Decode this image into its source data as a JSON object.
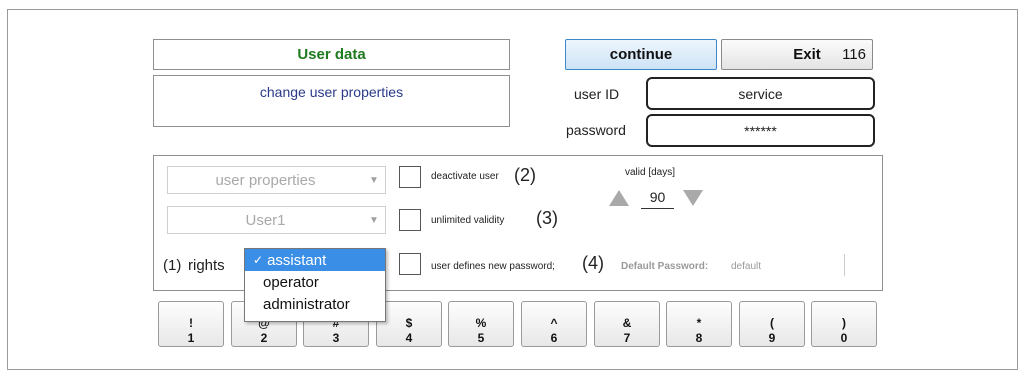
{
  "header": {
    "title": "User data",
    "subtitle": "change user properties",
    "continue_label": "continue",
    "exit_label": "Exit",
    "exit_number": "116"
  },
  "login": {
    "userid_label": "user ID",
    "userid_value": "service",
    "password_label": "password",
    "password_value": "******"
  },
  "settings": {
    "property_select": "user properties",
    "user_select": "User1",
    "rights_callout": "(1)",
    "rights_label": "rights",
    "rights_options": [
      "assistant",
      "operator",
      "administrator"
    ],
    "rights_selected_mark": "✓",
    "deactivate_label": "deactivate user",
    "deactivate_callout": "(2)",
    "unlimited_label": "unlimited validity",
    "unlimited_callout": "(3)",
    "newpw_label": "user defines new password;",
    "newpw_callout": "(4)",
    "default_pw_label": "Default Password:",
    "default_pw_value": "default",
    "valid_label": "valid [days]",
    "valid_value": "90"
  },
  "keypad": [
    {
      "top": "!",
      "bottom": "1"
    },
    {
      "top": "@",
      "bottom": "2"
    },
    {
      "top": "#",
      "bottom": "3"
    },
    {
      "top": "$",
      "bottom": "4"
    },
    {
      "top": "%",
      "bottom": "5"
    },
    {
      "top": "^",
      "bottom": "6"
    },
    {
      "top": "&",
      "bottom": "7"
    },
    {
      "top": "*",
      "bottom": "8"
    },
    {
      "top": "(",
      "bottom": "9"
    },
    {
      "top": ")",
      "bottom": "0"
    }
  ],
  "colors": {
    "title": "#1e7b1e",
    "subtitle": "#2a3a8a",
    "selection": "#3a8ee6",
    "continue_border": "#3b87c7"
  }
}
